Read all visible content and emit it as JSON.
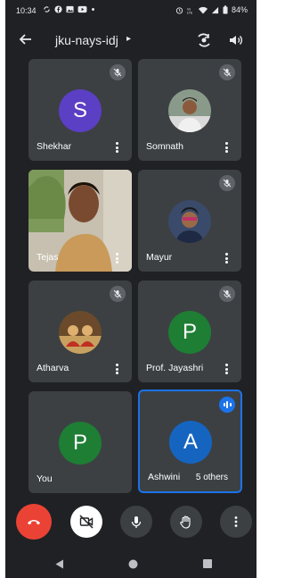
{
  "status_bar": {
    "time": "10:34",
    "left_icons": [
      "sync-icon",
      "facebook-icon",
      "gallery-icon",
      "youtube-icon",
      "dot-icon"
    ],
    "right_icons": [
      "alarm-icon",
      "volte-icon",
      "wifi-icon",
      "signal-icon",
      "battery-icon"
    ],
    "battery": "84%"
  },
  "header": {
    "meeting_code": "jku-nays-idj",
    "caret": "▸",
    "icons": [
      "back-arrow-icon",
      "switch-camera-icon",
      "speaker-icon"
    ]
  },
  "participants": [
    {
      "name": "Shekhar",
      "initial": "S",
      "avatar_color": "#5b3fc4",
      "muted": true
    },
    {
      "name": "Somnath",
      "initial": "",
      "photo": true,
      "muted": true
    },
    {
      "name": "Tejas",
      "initial": "",
      "video": true,
      "muted": true
    },
    {
      "name": "Mayur",
      "initial": "",
      "photo": true,
      "muted": true
    },
    {
      "name": "Atharva",
      "initial": "",
      "photo": true,
      "muted": true
    },
    {
      "name": "Prof. Jayashri",
      "initial": "P",
      "avatar_color": "#1e7e34",
      "muted": true
    },
    {
      "name": "You",
      "initial": "P",
      "avatar_color": "#1e7e34",
      "muted": false
    },
    {
      "name": "Ashwini",
      "initial": "A",
      "avatar_color": "#1565c0",
      "muted": false,
      "speaking": true
    }
  ],
  "others_chip": "5 others",
  "controls": [
    {
      "name": "end-call",
      "color": "#ea4335"
    },
    {
      "name": "camera-off",
      "color": "#ffffff"
    },
    {
      "name": "microphone",
      "color": "#3c4043"
    },
    {
      "name": "raise-hand",
      "color": "#3c4043"
    },
    {
      "name": "more-options",
      "color": "#3c4043"
    }
  ],
  "colors": {
    "background": "#202124",
    "tile": "#3c4043",
    "accent": "#1a73e8",
    "danger": "#ea4335"
  }
}
